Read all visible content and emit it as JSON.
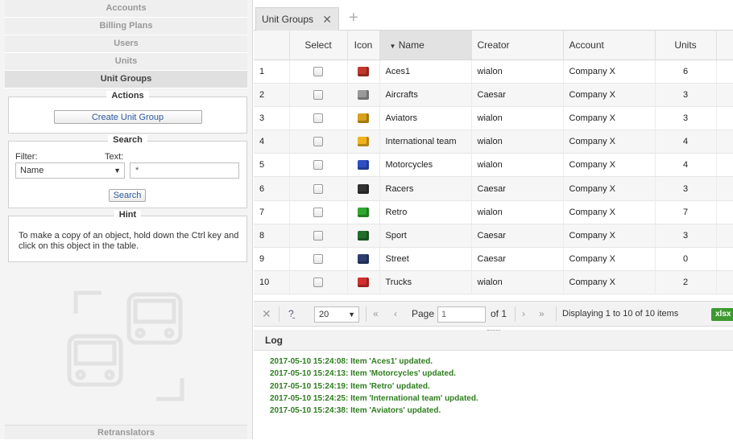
{
  "sidebar": {
    "nav": [
      "Accounts",
      "Billing Plans",
      "Users",
      "Units",
      "Unit Groups"
    ],
    "actions": {
      "legend": "Actions",
      "create_button": "Create Unit Group"
    },
    "search": {
      "legend": "Search",
      "filter_label": "Filter:",
      "filter_value": "Name",
      "text_label": "Text:",
      "text_value": "*",
      "search_button": "Search"
    },
    "hint": {
      "legend": "Hint",
      "text": "To make a copy of an object, hold down the Ctrl key and click on this object in the table."
    },
    "bottom_item": "Retranslators"
  },
  "tabs": {
    "active": "Unit Groups"
  },
  "table": {
    "columns": [
      "",
      "Select",
      "Icon",
      "Name",
      "Creator",
      "Account",
      "Units"
    ],
    "rows": [
      {
        "n": "1",
        "name": "Aces1",
        "creator": "wialon",
        "account": "Company X",
        "units": "6",
        "icon": "aces-icon",
        "color": "#c0392b"
      },
      {
        "n": "2",
        "name": "Aircrafts",
        "creator": "Caesar",
        "account": "Company X",
        "units": "3",
        "icon": "aircraft-icon",
        "color": "#9a9a9a"
      },
      {
        "n": "3",
        "name": "Aviators",
        "creator": "wialon",
        "account": "Company X",
        "units": "3",
        "icon": "aviator-icon",
        "color": "#d9a11a"
      },
      {
        "n": "4",
        "name": "International team",
        "creator": "wialon",
        "account": "Company X",
        "units": "4",
        "icon": "yellow-box-icon",
        "color": "#f1b31c"
      },
      {
        "n": "5",
        "name": "Motorcycles",
        "creator": "wialon",
        "account": "Company X",
        "units": "4",
        "icon": "blue-box-icon",
        "color": "#2d4fc4"
      },
      {
        "n": "6",
        "name": "Racers",
        "creator": "Caesar",
        "account": "Company X",
        "units": "3",
        "icon": "racer-car-icon",
        "color": "#333333"
      },
      {
        "n": "7",
        "name": "Retro",
        "creator": "wialon",
        "account": "Company X",
        "units": "7",
        "icon": "green-box-icon",
        "color": "#2fa82f"
      },
      {
        "n": "8",
        "name": "Sport",
        "creator": "Caesar",
        "account": "Company X",
        "units": "3",
        "icon": "sport-car-icon",
        "color": "#1f6e2a"
      },
      {
        "n": "9",
        "name": "Street",
        "creator": "Caesar",
        "account": "Company X",
        "units": "0",
        "icon": "street-car-icon",
        "color": "#2c3e70"
      },
      {
        "n": "10",
        "name": "Trucks",
        "creator": "wialon",
        "account": "Company X",
        "units": "2",
        "icon": "red-box-icon",
        "color": "#d0312d"
      }
    ]
  },
  "pager": {
    "page_size": "20",
    "page_label": "Page",
    "page_value": "1",
    "of_label": "of 1",
    "displaying": "Displaying 1 to 10 of 10 items",
    "export_label": "xlsx"
  },
  "log": {
    "title": "Log",
    "lines": [
      "2017-05-10 15:24:08: Item 'Aces1' updated.",
      "2017-05-10 15:24:13: Item 'Motorcycles' updated.",
      "2017-05-10 15:24:19: Item 'Retro' updated.",
      "2017-05-10 15:24:25: Item 'International team' updated.",
      "2017-05-10 15:24:38: Item 'Aviators' updated."
    ]
  }
}
